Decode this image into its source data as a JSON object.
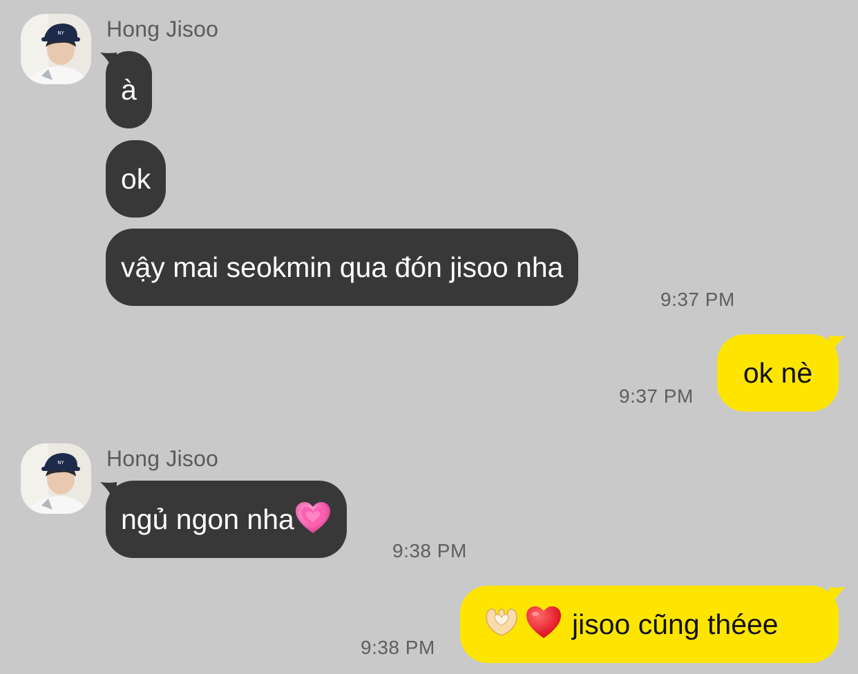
{
  "messages": {
    "group1": {
      "sender": "Hong Jisoo",
      "bubbles": [
        "à",
        "ok",
        "vậy mai seokmin qua đón jisoo nha"
      ],
      "time": "9:37 PM"
    },
    "reply1": {
      "text": "ok nè",
      "time": "9:37 PM"
    },
    "group2": {
      "sender": "Hong Jisoo",
      "text": "ngủ ngon nha",
      "emoji": "growing-heart",
      "time": "9:38 PM"
    },
    "reply2": {
      "text": "jisoo cũng théee",
      "emojis": [
        "heart-hands",
        "red-heart"
      ],
      "time": "9:38 PM"
    }
  },
  "colors": {
    "background": "#c9c9c9",
    "incoming_bubble": "#383838",
    "outgoing_bubble": "#fee500",
    "timestamp": "#5e5e5e",
    "sender_name": "#5b5b5b"
  }
}
